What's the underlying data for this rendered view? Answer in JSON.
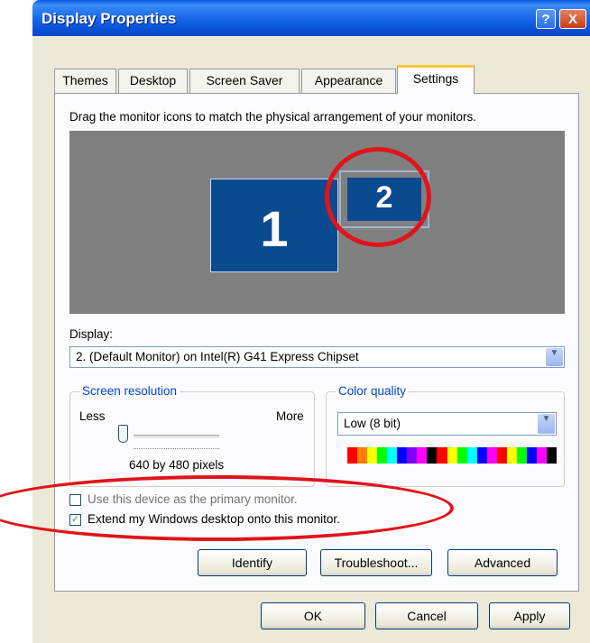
{
  "window": {
    "title": "Display Properties",
    "help_glyph": "?",
    "close_glyph": "X"
  },
  "tabs": [
    {
      "label": "Themes",
      "active": false
    },
    {
      "label": "Desktop",
      "active": false
    },
    {
      "label": "Screen Saver",
      "active": false
    },
    {
      "label": "Appearance",
      "active": false
    },
    {
      "label": "Settings",
      "active": true
    }
  ],
  "settings": {
    "instruction": "Drag the monitor icons to match the physical arrangement of your monitors.",
    "monitors": [
      {
        "label": "1",
        "selected": false
      },
      {
        "label": "2",
        "selected": true
      }
    ],
    "display_label": "Display:",
    "display_value": "2. (Default Monitor) on Intel(R) G41 Express Chipset",
    "resolution": {
      "legend": "Screen resolution",
      "less": "Less",
      "more": "More",
      "value": "640 by 480 pixels",
      "slider_level": 0.0
    },
    "color": {
      "legend": "Color quality",
      "value": "Low (8 bit)",
      "swatches": [
        "#ffffff",
        "#ff0000",
        "#ff7f00",
        "#ffff00",
        "#00ff00",
        "#00ffff",
        "#0000ff",
        "#8000ff",
        "#ff00ff",
        "#000000",
        "#ff0000",
        "#ffff00",
        "#00ff00",
        "#00ffff",
        "#0000ff",
        "#ff00ff",
        "#ff0000",
        "#ffff00",
        "#00ff00",
        "#0000ff",
        "#ff00ff",
        "#000000"
      ]
    },
    "primary_checkbox": {
      "label": "Use this device as the primary monitor.",
      "checked": false
    },
    "extend_checkbox": {
      "label": "Extend my Windows desktop onto this monitor.",
      "checked": true
    }
  },
  "buttons": {
    "identify": "Identify",
    "troubleshoot": "Troubleshoot...",
    "advanced": "Advanced",
    "ok": "OK",
    "cancel": "Cancel",
    "apply": "Apply"
  },
  "annotation_color": "#e0141a"
}
